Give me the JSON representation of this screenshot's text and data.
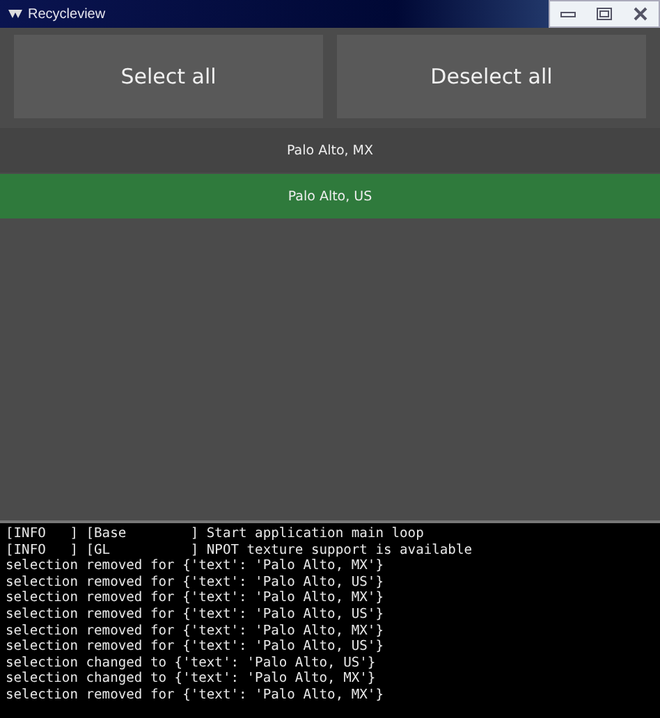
{
  "window": {
    "title": "Recycleview"
  },
  "buttons": [
    "Select all",
    "Deselect all"
  ],
  "rows": [
    {
      "label": "Palo Alto, MX",
      "selected": false
    },
    {
      "label": "Palo Alto, US",
      "selected": true
    }
  ],
  "console": {
    "lines": [
      "[INFO   ] [Base        ] Start application main loop",
      "[INFO   ] [GL          ] NPOT texture support is available",
      "selection removed for {'text': 'Palo Alto, MX'}",
      "selection removed for {'text': 'Palo Alto, US'}",
      "selection removed for {'text': 'Palo Alto, MX'}",
      "selection removed for {'text': 'Palo Alto, US'}",
      "selection removed for {'text': 'Palo Alto, MX'}",
      "selection removed for {'text': 'Palo Alto, US'}",
      "selection changed to {'text': 'Palo Alto, US'}",
      "selection changed to {'text': 'Palo Alto, MX'}",
      "selection removed for {'text': 'Palo Alto, MX'}"
    ]
  }
}
